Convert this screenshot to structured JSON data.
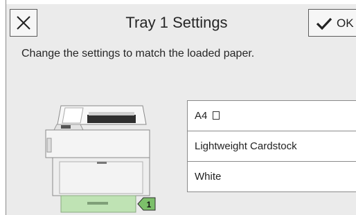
{
  "header": {
    "title": "Tray 1 Settings",
    "close_icon": "close-icon",
    "ok_label": "OK",
    "ok_icon": "checkmark-icon"
  },
  "instruction": "Change the settings to match the loaded paper.",
  "printer": {
    "tray_badge": "1",
    "highlight_color": "#bfe3b4",
    "badge_color": "#7cbf6a"
  },
  "settings": [
    {
      "label": "A4",
      "icon": "portrait-paper-icon"
    },
    {
      "label": "Lightweight Cardstock"
    },
    {
      "label": "White"
    }
  ]
}
